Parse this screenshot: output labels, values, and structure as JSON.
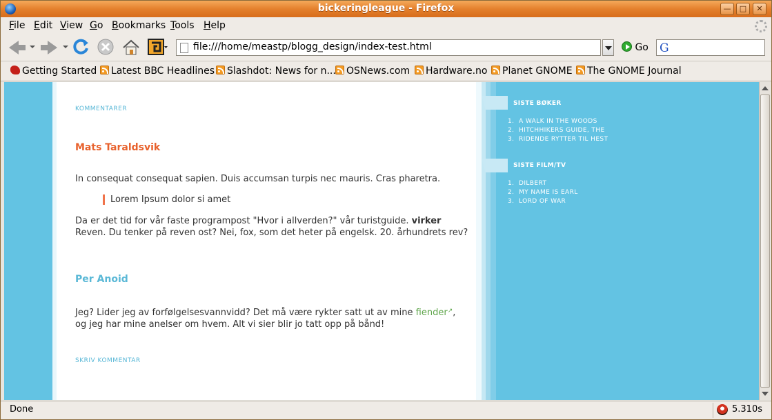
{
  "window": {
    "title": "bickeringleague - Firefox"
  },
  "menu": [
    {
      "label": "File",
      "u": "F",
      "rest": "ile"
    },
    {
      "label": "Edit",
      "u": "E",
      "rest": "dit"
    },
    {
      "label": "View",
      "u": "V",
      "rest": "iew"
    },
    {
      "label": "Go",
      "u": "G",
      "rest": "o"
    },
    {
      "label": "Bookmarks",
      "u": "B",
      "rest": "ookmarks"
    },
    {
      "label": "Tools",
      "u": "T",
      "rest": "ools"
    },
    {
      "label": "Help",
      "u": "H",
      "rest": "elp"
    }
  ],
  "nav": {
    "url": "file:///home/meastp/blogg_design/index-test.html",
    "go_label": "Go",
    "search_value": ""
  },
  "bookmarks": [
    {
      "label": "Getting Started",
      "icon": "red-hat-icon"
    },
    {
      "label": "Latest BBC Headlines",
      "icon": "rss-feed-icon"
    },
    {
      "label": "Slashdot: News for n...",
      "icon": "rss-feed-icon"
    },
    {
      "label": "OSNews.com",
      "icon": "rss-feed-icon"
    },
    {
      "label": "Hardware.no",
      "icon": "rss-feed-icon"
    },
    {
      "label": "Planet GNOME",
      "icon": "rss-feed-icon"
    },
    {
      "label": "The GNOME Journal",
      "icon": "rss-feed-icon"
    }
  ],
  "page": {
    "comments_heading": "KOMMENTARER",
    "comment1": {
      "author": "Mats Taraldsvik",
      "author_color": "#e8612c",
      "intro": "In consequat consequat sapien. Duis accumsan turpis nec mauris. Cras pharetra.",
      "quote": "Lorem Ipsum dolor si amet",
      "body_1": "Da er det tid for vår faste programpost \"Hvor i allverden?\" vår turistguide. ",
      "body_bold": "virker",
      "body_2": " Reven. Du tenker på reven ost? Nei, fox, som det heter på engelsk. 20. århundrets rev?"
    },
    "comment2": {
      "author": "Per Anoid",
      "author_color": "#5ab8d6",
      "body_1": "Jeg? Lider jeg av forfølgelsesvannvidd? Det må være rykter satt ut av mine ",
      "link": "fiender",
      "body_2": ", og jeg har mine anelser om hvem. Alt vi sier blir jo tatt opp på bånd!"
    },
    "write_comment": "SKRIV KOMMENTAR"
  },
  "sidebar": {
    "books_heading": "SISTE BØKER",
    "books": [
      "A WALK IN THE WOODS",
      "HITCHHIKERS GUIDE, THE",
      "RIDENDE RYTTER TIL HEST"
    ],
    "films_heading": "SISTE FILM/TV",
    "films": [
      "DILBERT",
      "MY NAME IS EARL",
      "LORD OF WAR"
    ]
  },
  "status": {
    "text": "Done",
    "timer": "5.310s"
  },
  "colors": {
    "page_bg": "#63c3e3",
    "titlebar": "#e4802d"
  }
}
